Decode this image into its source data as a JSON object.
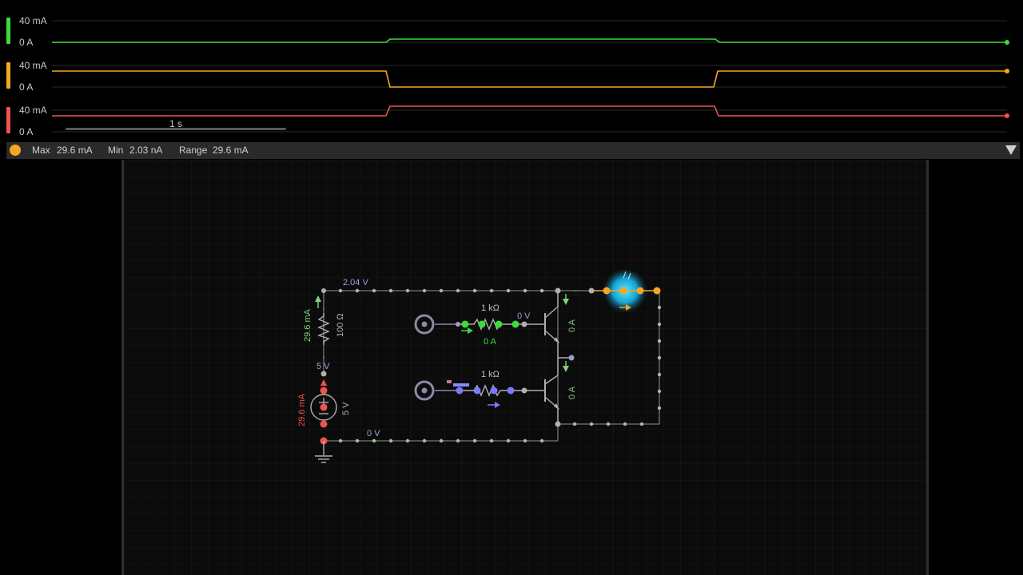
{
  "scope": {
    "rows": [
      {
        "name": "green-trace",
        "color": "#3ddc3d",
        "top_label": "40 mA",
        "bottom_label": "0 A"
      },
      {
        "name": "orange-trace",
        "color": "#f5a623",
        "top_label": "40 mA",
        "bottom_label": "0 A"
      },
      {
        "name": "red-trace",
        "color": "#ef5350",
        "top_label": "40 mA",
        "bottom_label": "0 A"
      }
    ],
    "time_scale_label": "1 s"
  },
  "info_bar": {
    "accent_color": "#f5a623",
    "max_label": "Max",
    "max_value": "29.6 mA",
    "min_label": "Min",
    "min_value": "2.03 nA",
    "range_label": "Range",
    "range_value": "29.6 mA"
  },
  "circuit": {
    "labels": {
      "top_node_voltage": "2.04 V",
      "resistor_current": "29.6 mA",
      "resistor_value": "100 Ω",
      "mid_node_voltage": "5 V",
      "source_current": "29.6 mA",
      "source_voltage": "5 V",
      "bottom_node_voltage": "0 V",
      "r1_value": "1 kΩ",
      "r1_voltage": "0 V",
      "r1_current": "0 A",
      "r2_value": "1 kΩ",
      "q1_current": "0 A",
      "q2_current": "0 A"
    }
  }
}
